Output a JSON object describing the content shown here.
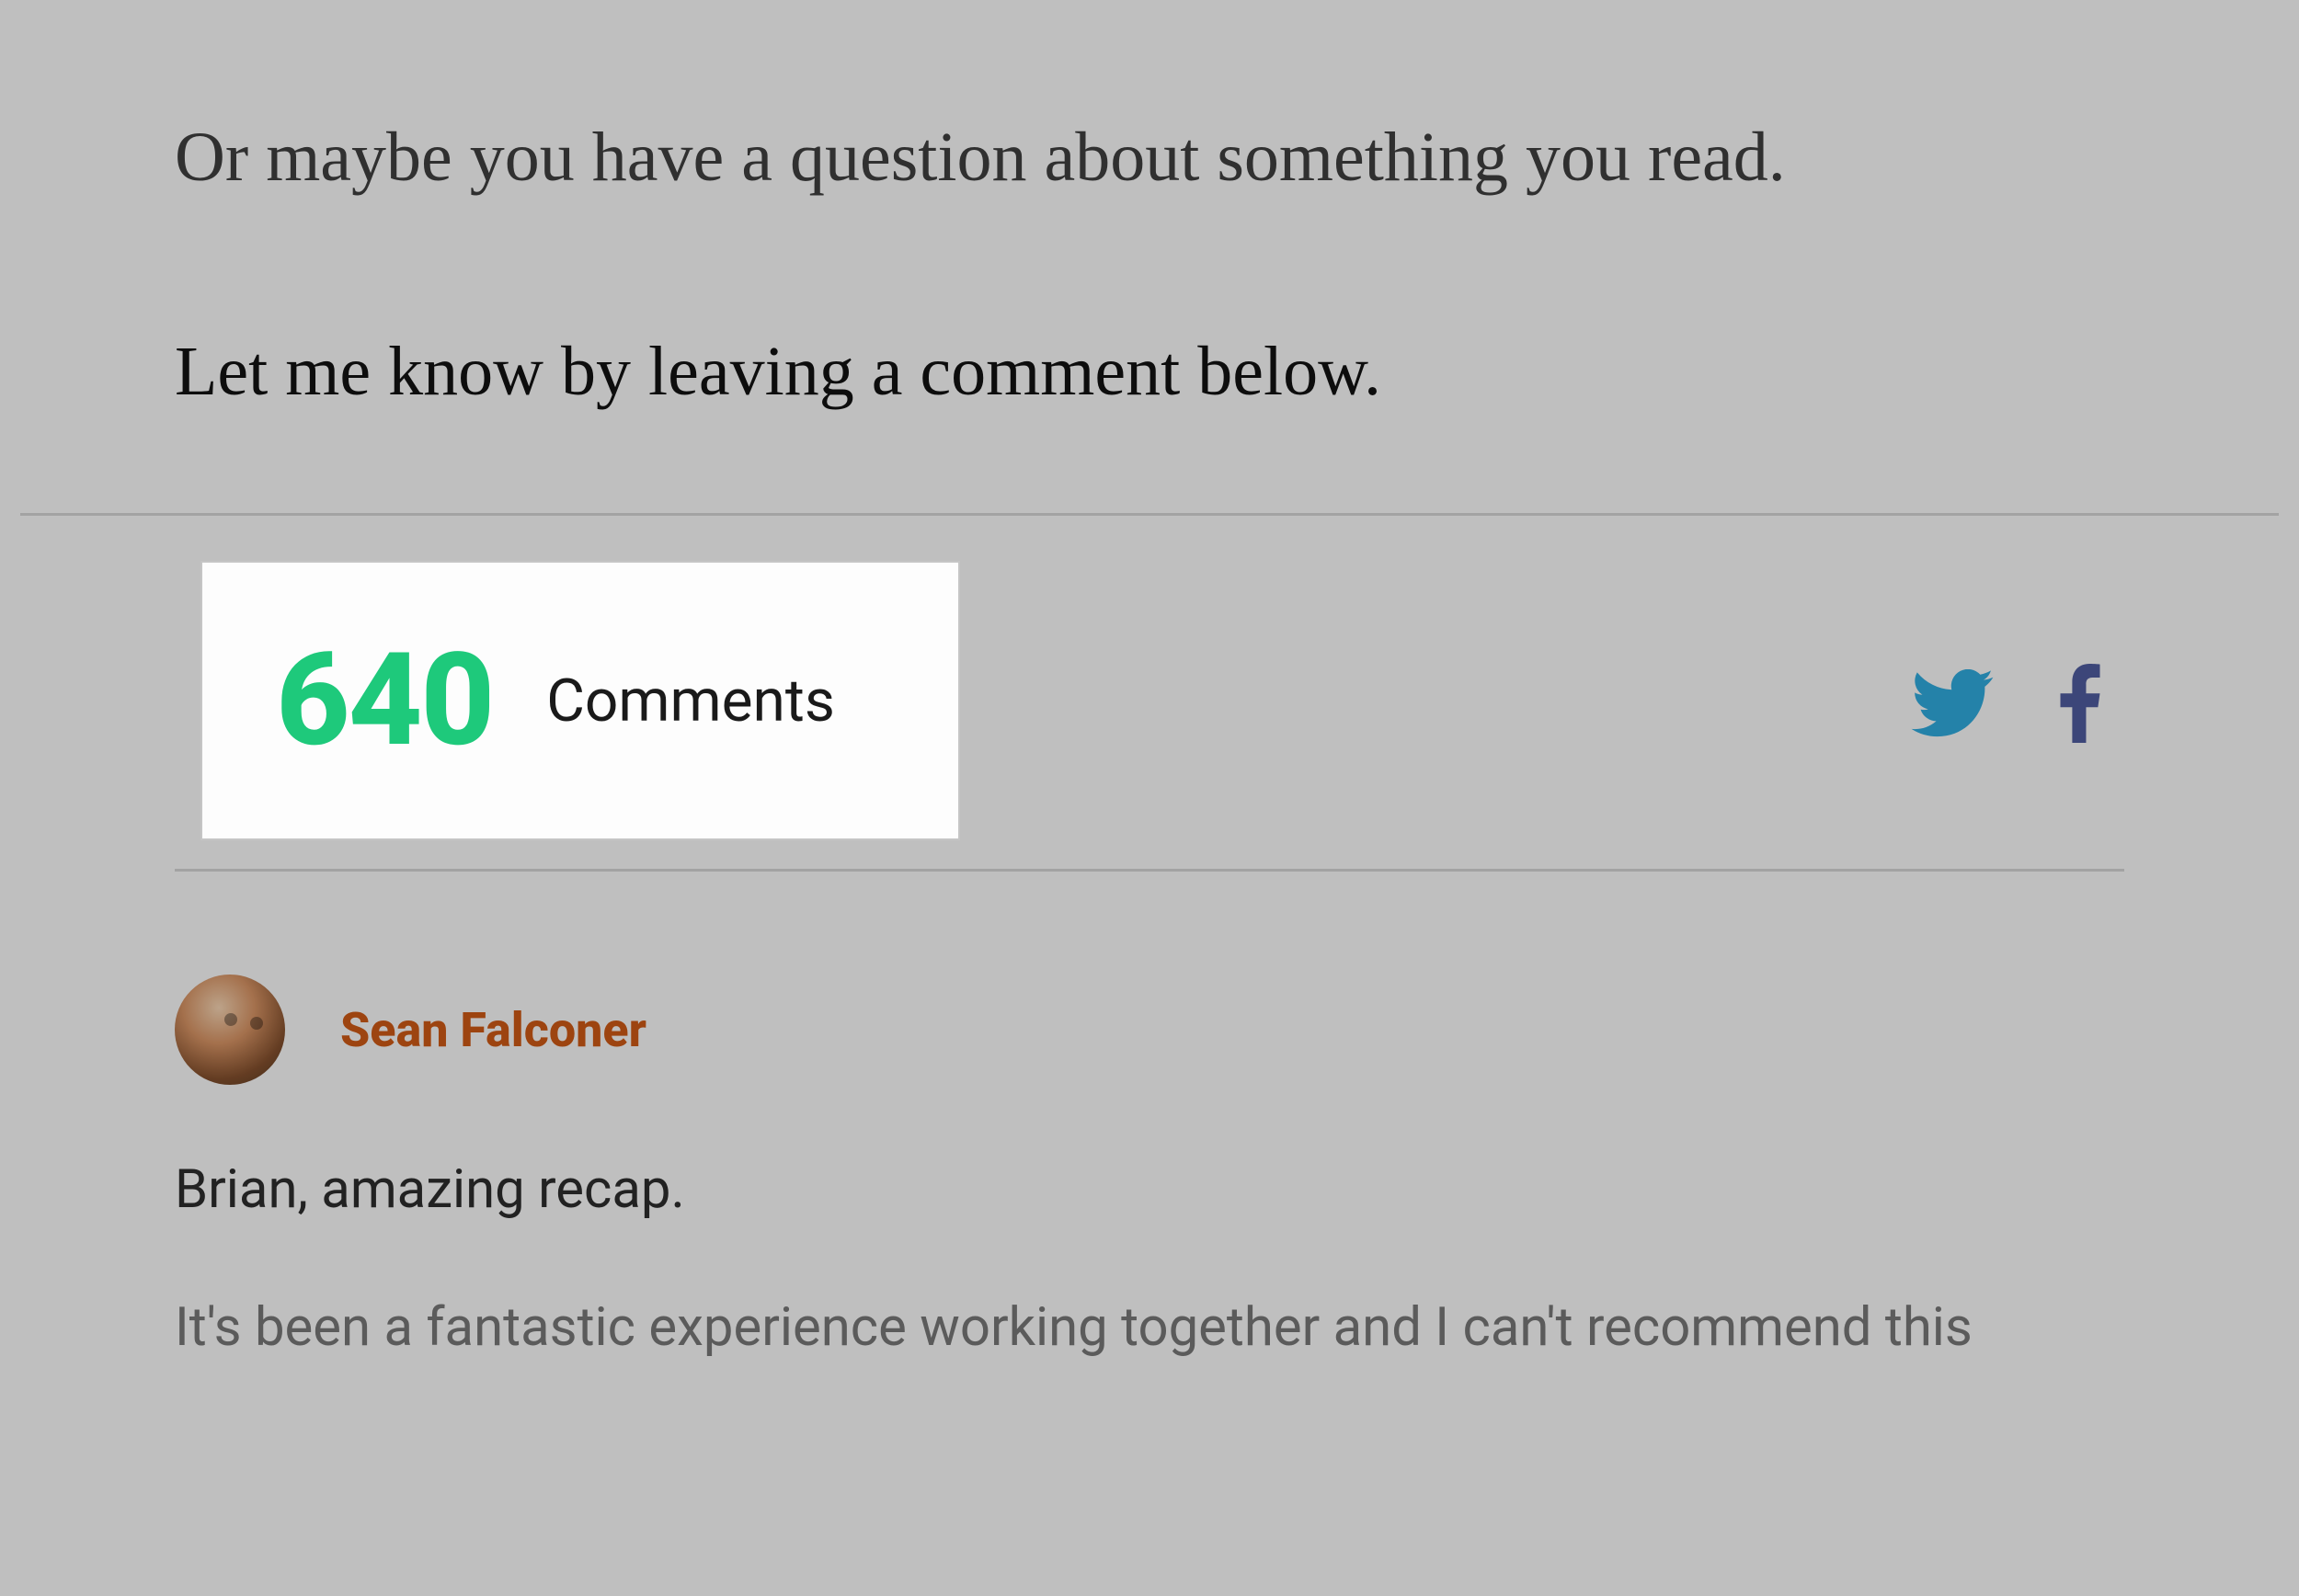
{
  "article": {
    "p1": "Or maybe you have a question about something you read.",
    "p2": "Let me know by leaving a comment below."
  },
  "comments_header": {
    "count": "640",
    "label": "Comments"
  },
  "share_icons": {
    "twitter": "twitter-icon",
    "facebook": "facebook-icon"
  },
  "comment": {
    "author": "Sean Falconer",
    "body_line1": "Brian, amazing recap.",
    "body_line2": "It's been a fantastic experience working together and I can't recommend this"
  },
  "colors": {
    "accent_green": "#1ec97b",
    "author_link": "#c05414",
    "twitter": "#2d9fcf",
    "facebook": "#4a5694"
  }
}
